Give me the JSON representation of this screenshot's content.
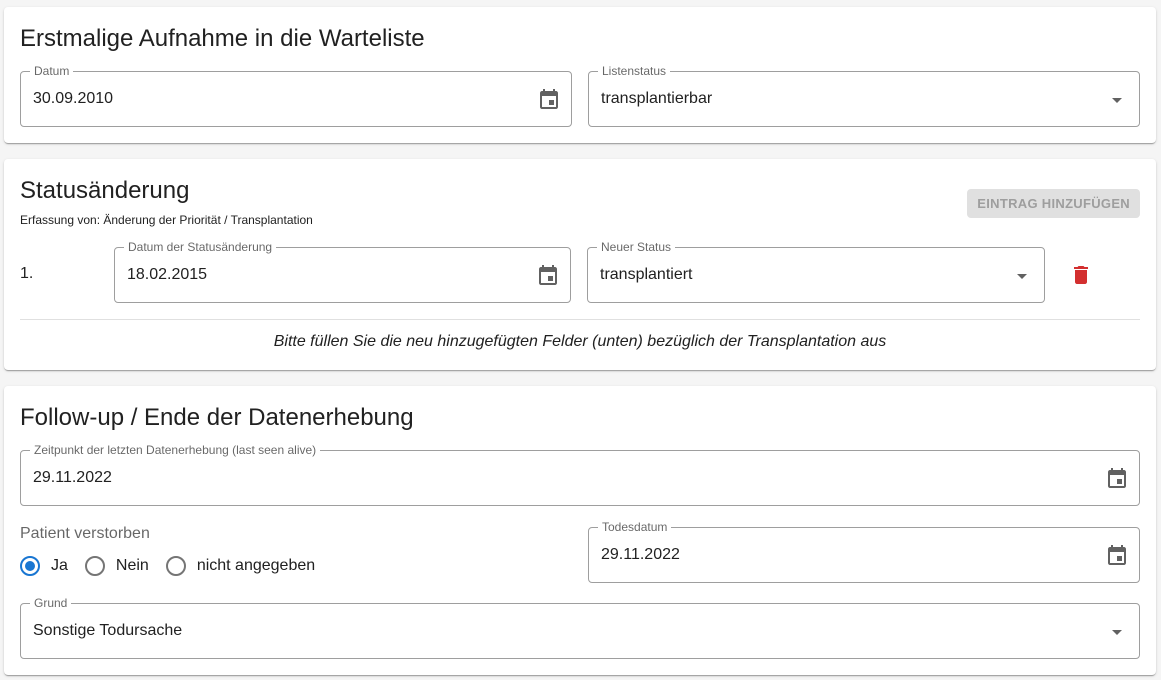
{
  "colors": {
    "primary": "#1976d2",
    "delete": "#d32f2f",
    "icon": "#616161",
    "disabled_bg": "#e0e0e0",
    "disabled_text": "#9e9e9e"
  },
  "icons": {
    "calendar": "calendar-icon",
    "dropdown": "arrow-drop-down-icon",
    "delete": "trash-icon"
  },
  "first_listing": {
    "title": "Erstmalige Aufnahme in die Warteliste",
    "date_label": "Datum",
    "date_value": "30.09.2010",
    "status_label": "Listenstatus",
    "status_value": "transplantierbar"
  },
  "status_change": {
    "title": "Statusänderung",
    "subtitle": "Erfassung von: Änderung der Priorität / Transplantation",
    "add_button": "EINTRAG HINZUFÜGEN",
    "entries": [
      {
        "number": "1.",
        "date_label": "Datum der Statusänderung",
        "date_value": "18.02.2015",
        "status_label": "Neuer Status",
        "status_value": "transplantiert"
      }
    ],
    "note": "Bitte füllen Sie die neu hinzugefügten Felder (unten) bezüglich der Transplantation aus"
  },
  "followup": {
    "title": "Follow-up / Ende der Datenerhebung",
    "last_seen_label": "Zeitpunkt der letzten Datenerhebung (last seen alive)",
    "last_seen_value": "29.11.2022",
    "deceased_label": "Patient verstorben",
    "deceased_options": [
      "Ja",
      "Nein",
      "nicht angegeben"
    ],
    "deceased_selected": "Ja",
    "death_date_label": "Todesdatum",
    "death_date_value": "29.11.2022",
    "reason_label": "Grund",
    "reason_value": "Sonstige Todursache"
  }
}
